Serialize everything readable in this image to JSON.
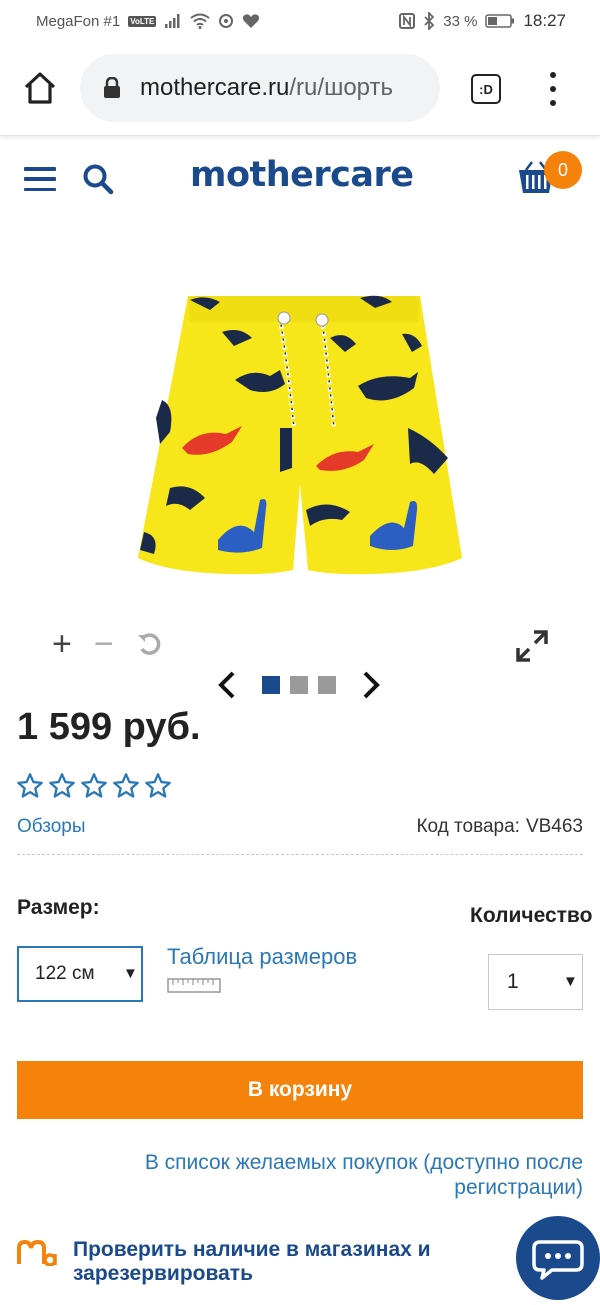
{
  "status_bar": {
    "carrier": "MegaFon #1",
    "volte": "VoLTE",
    "battery": "33 %",
    "time": "18:27"
  },
  "browser": {
    "url_host": "mothercare.ru",
    "url_path": "/ru/шорть",
    "tabs_label": ":D"
  },
  "header": {
    "logo": "mothercare",
    "cart_count": "0"
  },
  "gallery": {
    "zoom_in": "+",
    "zoom_out": "−",
    "slide_count": 3,
    "active_slide": 1
  },
  "product": {
    "price": "1 599 руб.",
    "rating": 0,
    "reviews_link": "Обзоры",
    "sku_label": "Код товара:",
    "sku_value": "VB463"
  },
  "options": {
    "size_label": "Размер:",
    "size_value": "122 см",
    "size_table_link": "Таблица размеров",
    "qty_label": "Количество",
    "qty_value": "1"
  },
  "actions": {
    "add_to_cart": "В корзину",
    "wishlist_line1": "В список желаемых покупок (доступно после",
    "wishlist_line2": "регистрации)",
    "store_check_line1": "Проверить наличие в магазинах и",
    "store_check_line2": "зарезервировать"
  },
  "colors": {
    "brand_blue": "#1b4a8c",
    "link_blue": "#2a78b8",
    "accent_orange": "#f5820b",
    "shorts_yellow": "#f7e71a"
  }
}
